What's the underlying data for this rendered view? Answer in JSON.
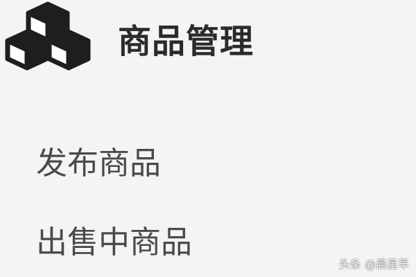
{
  "menu": {
    "section": {
      "icon": "cubes-icon",
      "title": "商品管理"
    },
    "items": [
      {
        "label": "发布商品"
      },
      {
        "label": "出售中商品"
      }
    ]
  },
  "watermark": "头条 @晨星早",
  "colors": {
    "background": "#f4f4f4",
    "title": "#2b2b2b",
    "item_text": "#4a4a4a",
    "icon": "#1e1e1e"
  }
}
